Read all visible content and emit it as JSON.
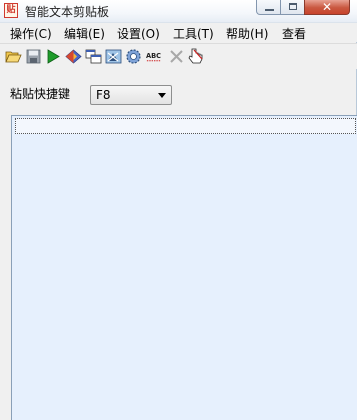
{
  "window": {
    "title": "智能文本剪贴板",
    "app_icon_glyph": "贴",
    "close_glyph": "✕"
  },
  "menu": {
    "items": [
      {
        "label": "操作(C)"
      },
      {
        "label": "编辑(E)"
      },
      {
        "label": "设置(O)"
      },
      {
        "label": "工具(T)"
      },
      {
        "label": "帮助(H)"
      },
      {
        "label": "查看"
      }
    ]
  },
  "toolbar": {
    "buttons": [
      {
        "icon": "open-folder-icon"
      },
      {
        "icon": "save-icon"
      },
      {
        "icon": "play-icon"
      },
      {
        "icon": "diamond-icon"
      },
      {
        "icon": "copy-windows-icon"
      },
      {
        "icon": "window-image-icon"
      },
      {
        "icon": "gear-icon"
      },
      {
        "icon": "spell-check-icon",
        "text": "ABC"
      },
      {
        "icon": "delete-icon"
      },
      {
        "icon": "pointer-hand-icon"
      }
    ]
  },
  "hotkey": {
    "label": "粘贴快捷键",
    "value": "F8"
  },
  "colors": {
    "content_background": "#e6f0fd",
    "play_green": "#1e9c2a",
    "close_red": "#c8432c"
  }
}
